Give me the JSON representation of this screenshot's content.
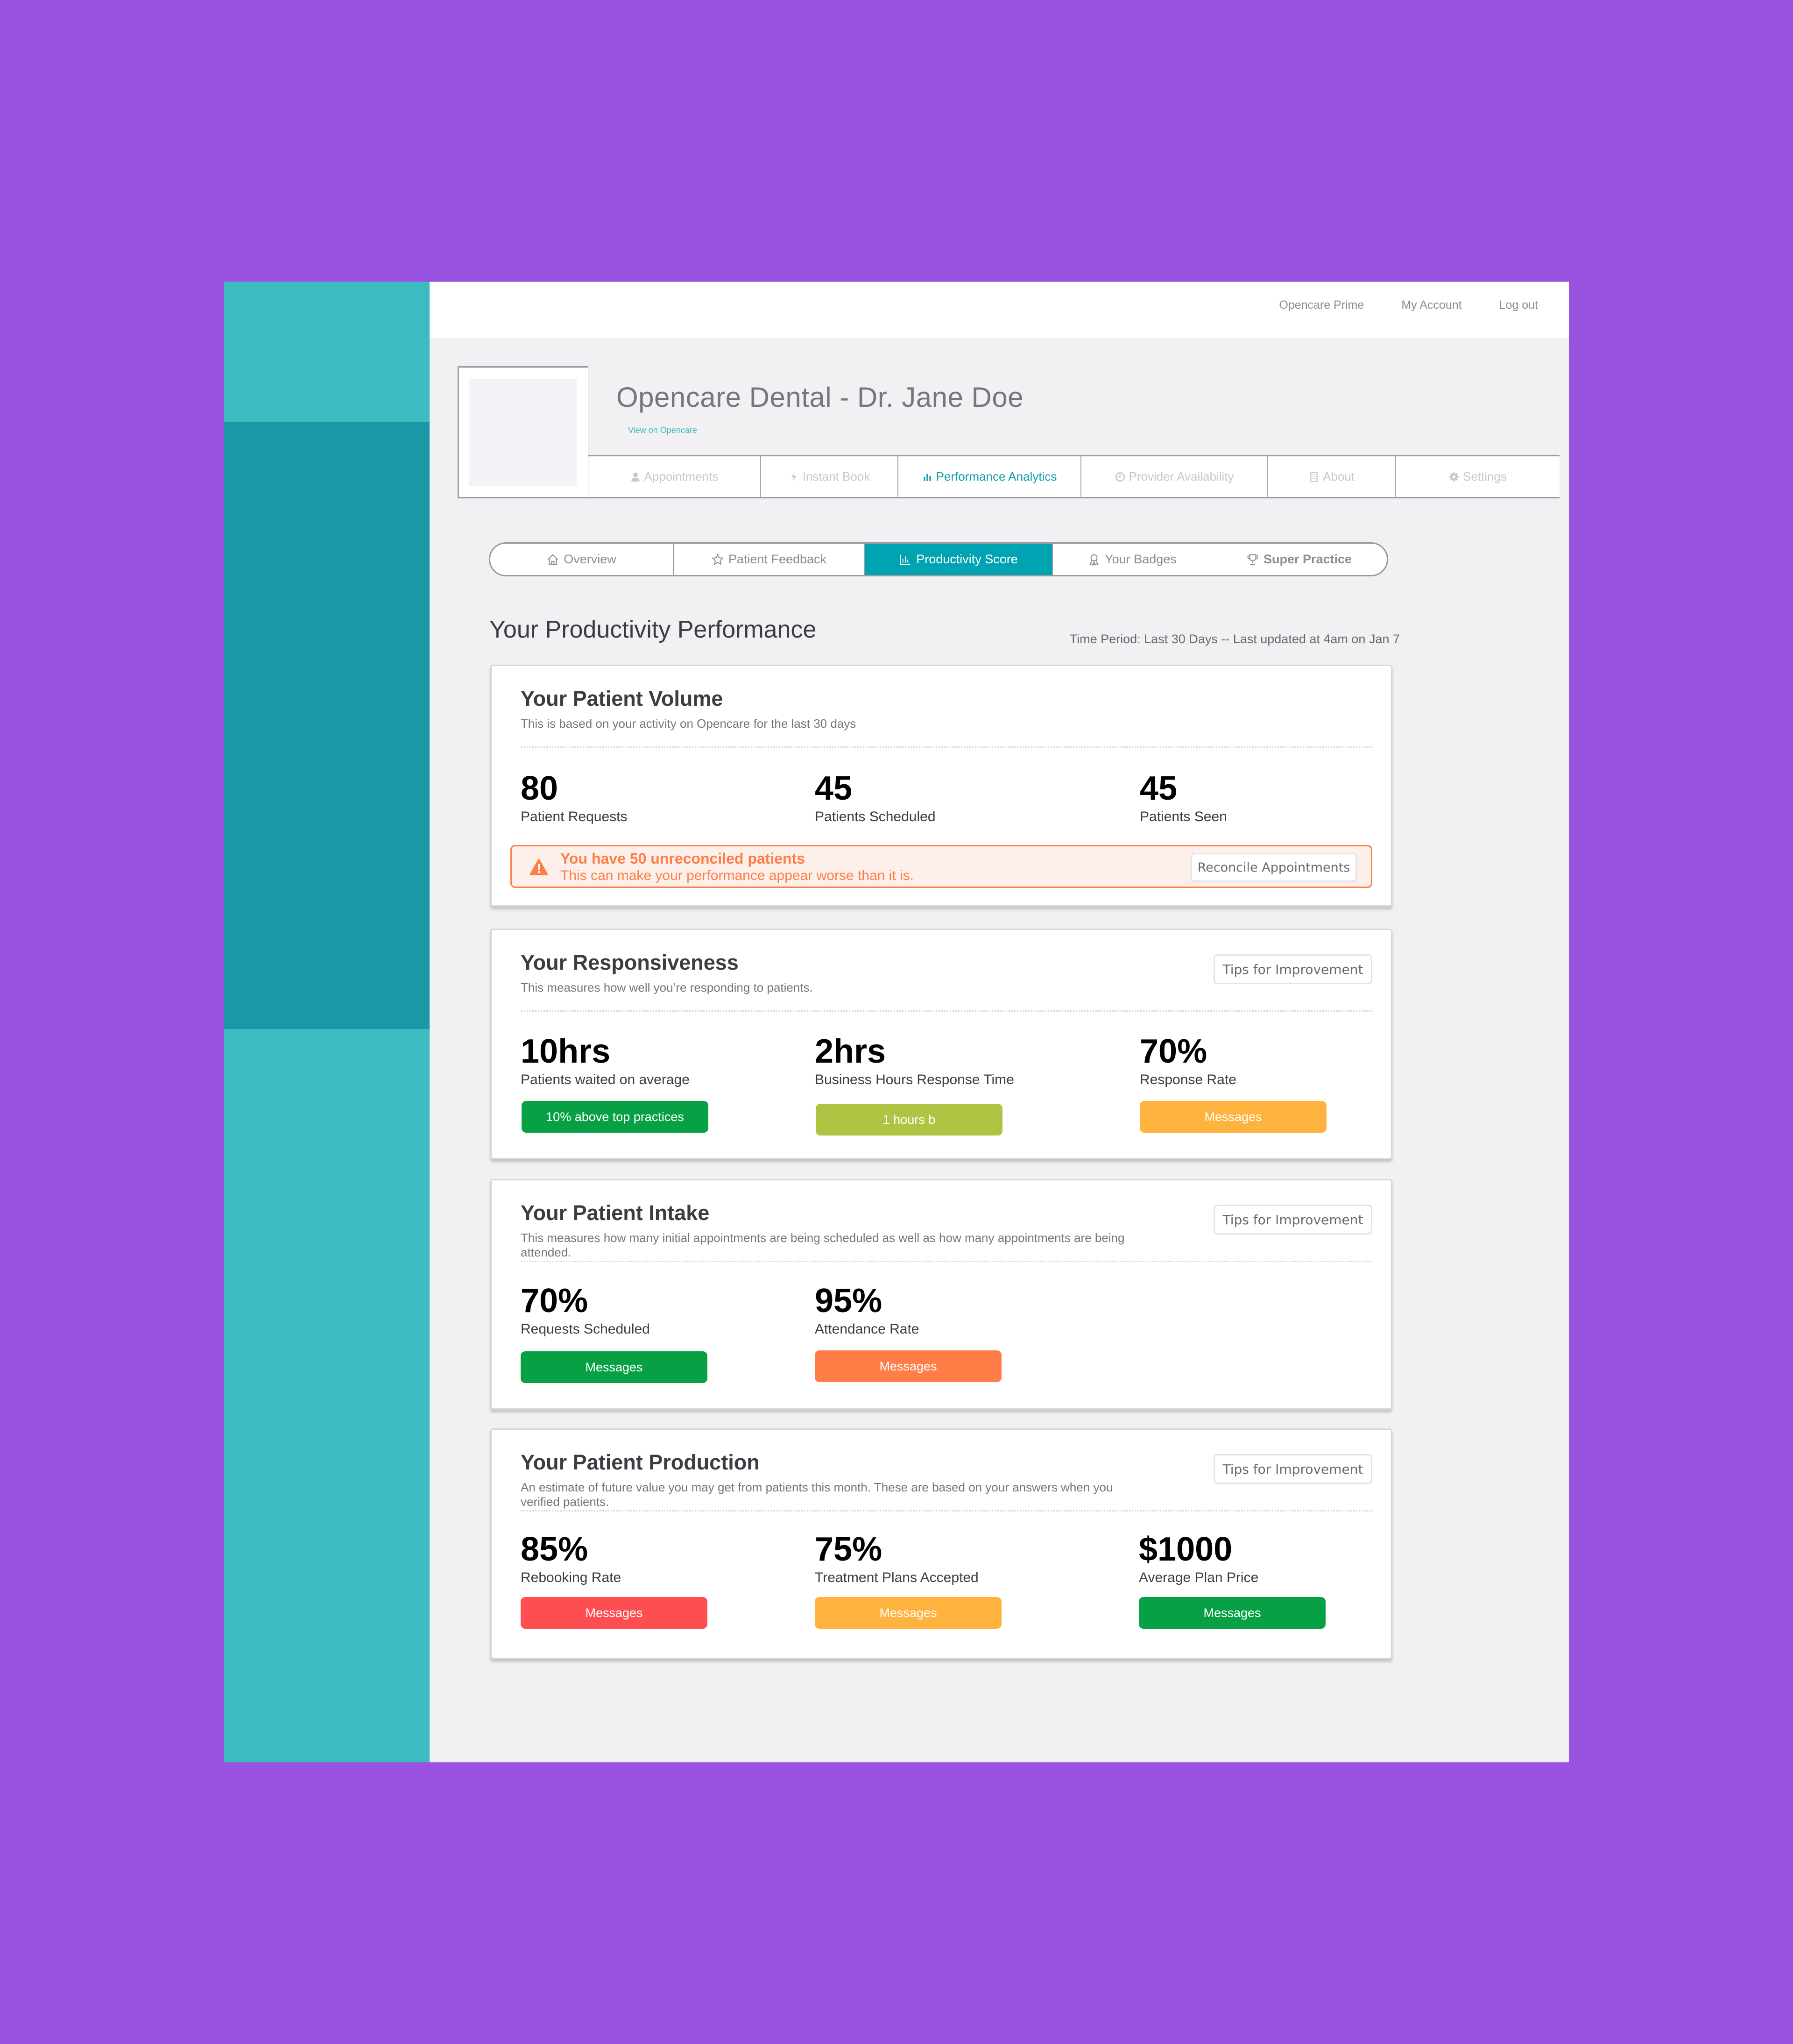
{
  "topbar": {
    "links": [
      "Opencare Prime",
      "My Account",
      "Log out"
    ]
  },
  "profile": {
    "name": "Opencare Dental - Dr. Jane Doe",
    "view_link": "View on Opencare"
  },
  "main_tabs": [
    {
      "label": "Appointments",
      "icon": "user-icon"
    },
    {
      "label": "Instant Book",
      "icon": "bolt-icon"
    },
    {
      "label": "Performance Analytics",
      "icon": "bar-chart-icon",
      "active": true
    },
    {
      "label": "Provider Availability",
      "icon": "clock-icon"
    },
    {
      "label": "About",
      "icon": "building-icon"
    },
    {
      "label": "Settings",
      "icon": "gear-icon"
    }
  ],
  "sub_tabs": [
    {
      "label": "Overview",
      "icon": "home-icon"
    },
    {
      "label": "Patient Feedback",
      "icon": "star-icon"
    },
    {
      "label": "Productivity Score",
      "icon": "bar-chart-icon",
      "active": true
    },
    {
      "label": "Your Badges",
      "icon": "ribbon-icon"
    },
    {
      "label": "Super Practice",
      "icon": "trophy-icon"
    }
  ],
  "section": {
    "title": "Your Productivity Performance",
    "time_period": "Time Period: Last 30 Days -- Last updated at 4am on Jan 7"
  },
  "colors": {
    "accent": "#00A3B2",
    "green": "#08A045",
    "lime": "#B0C443",
    "amber": "#FFB33F",
    "orange": "#FF7E47",
    "red": "#FF4E51",
    "background": "#9A52E0"
  },
  "cards": {
    "volume": {
      "title": "Your Patient Volume",
      "desc": "This is based on your activity on Opencare for the last 30 days",
      "metrics": [
        {
          "value": "80",
          "label": "Patient Requests"
        },
        {
          "value": "45",
          "label": "Patients Scheduled"
        },
        {
          "value": "45",
          "label": "Patients Seen"
        }
      ],
      "warning": {
        "title": "You have 50 unreconciled patients",
        "subtitle": "This can make your performance appear worse than it is.",
        "button": "Reconcile Appointments"
      }
    },
    "responsiveness": {
      "title": "Your Responsiveness",
      "desc": "This measures how well you’re responding to patients.",
      "tips": "Tips for Improvement",
      "metrics": [
        {
          "value": "10hrs",
          "label": "Patients waited on average",
          "pill": "10% above top practices"
        },
        {
          "value": "2hrs",
          "label": "Business Hours Response Time",
          "pill": "1 hours b"
        },
        {
          "value": "70%",
          "label": "Response Rate",
          "pill": "Messages"
        }
      ]
    },
    "intake": {
      "title": "Your Patient Intake",
      "desc": "This measures how many initial appointments are being scheduled as well as how many appointments are being attended.",
      "tips": "Tips for Improvement",
      "metrics": [
        {
          "value": "70%",
          "label": "Requests Scheduled",
          "pill": "Messages"
        },
        {
          "value": "95%",
          "label": "Attendance Rate",
          "pill": "Messages"
        }
      ]
    },
    "production": {
      "title": "Your Patient Production",
      "desc": "An estimate of future value you may get from patients this month. These are based on your answers when you verified patients.",
      "tips": "Tips for Improvement",
      "metrics": [
        {
          "value": "85%",
          "label": "Rebooking Rate",
          "pill": "Messages"
        },
        {
          "value": "75%",
          "label": "Treatment Plans Accepted",
          "pill": "Messages"
        },
        {
          "value": "$1000",
          "label": "Average Plan Price",
          "pill": "Messages"
        }
      ]
    }
  }
}
